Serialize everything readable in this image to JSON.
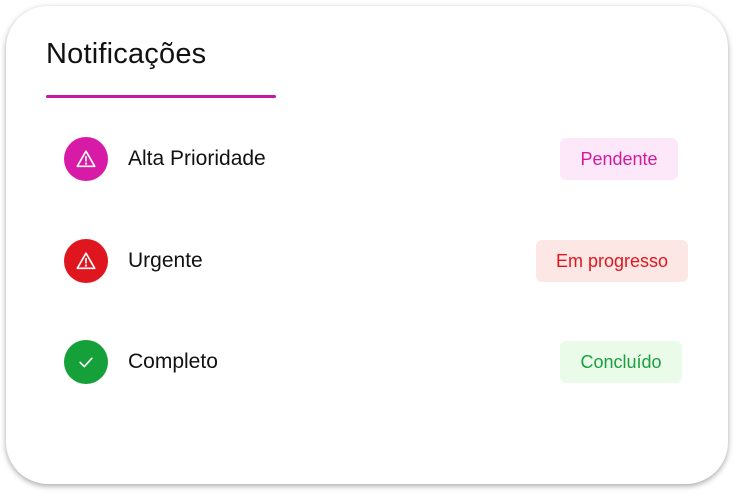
{
  "header": {
    "title": "Notificações"
  },
  "colors": {
    "accent": "#c21aa1",
    "magenta": "#d81ba7",
    "red": "#e0161e",
    "green": "#15a03a"
  },
  "items": [
    {
      "label": "Alta Prioridade",
      "icon": "warning-icon",
      "icon_color": "#d81ba7",
      "status": "Pendente",
      "status_text_color": "#d01aa0",
      "status_bg_color": "#fce8f9"
    },
    {
      "label": "Urgente",
      "icon": "warning-icon",
      "icon_color": "#e0161e",
      "status": "Em progresso",
      "status_text_color": "#e0161e",
      "status_bg_color": "#fde7e5"
    },
    {
      "label": "Completo",
      "icon": "check-icon",
      "icon_color": "#15a03a",
      "status": "Concluído",
      "status_text_color": "#1aa03e",
      "status_bg_color": "#eafbe9"
    }
  ]
}
